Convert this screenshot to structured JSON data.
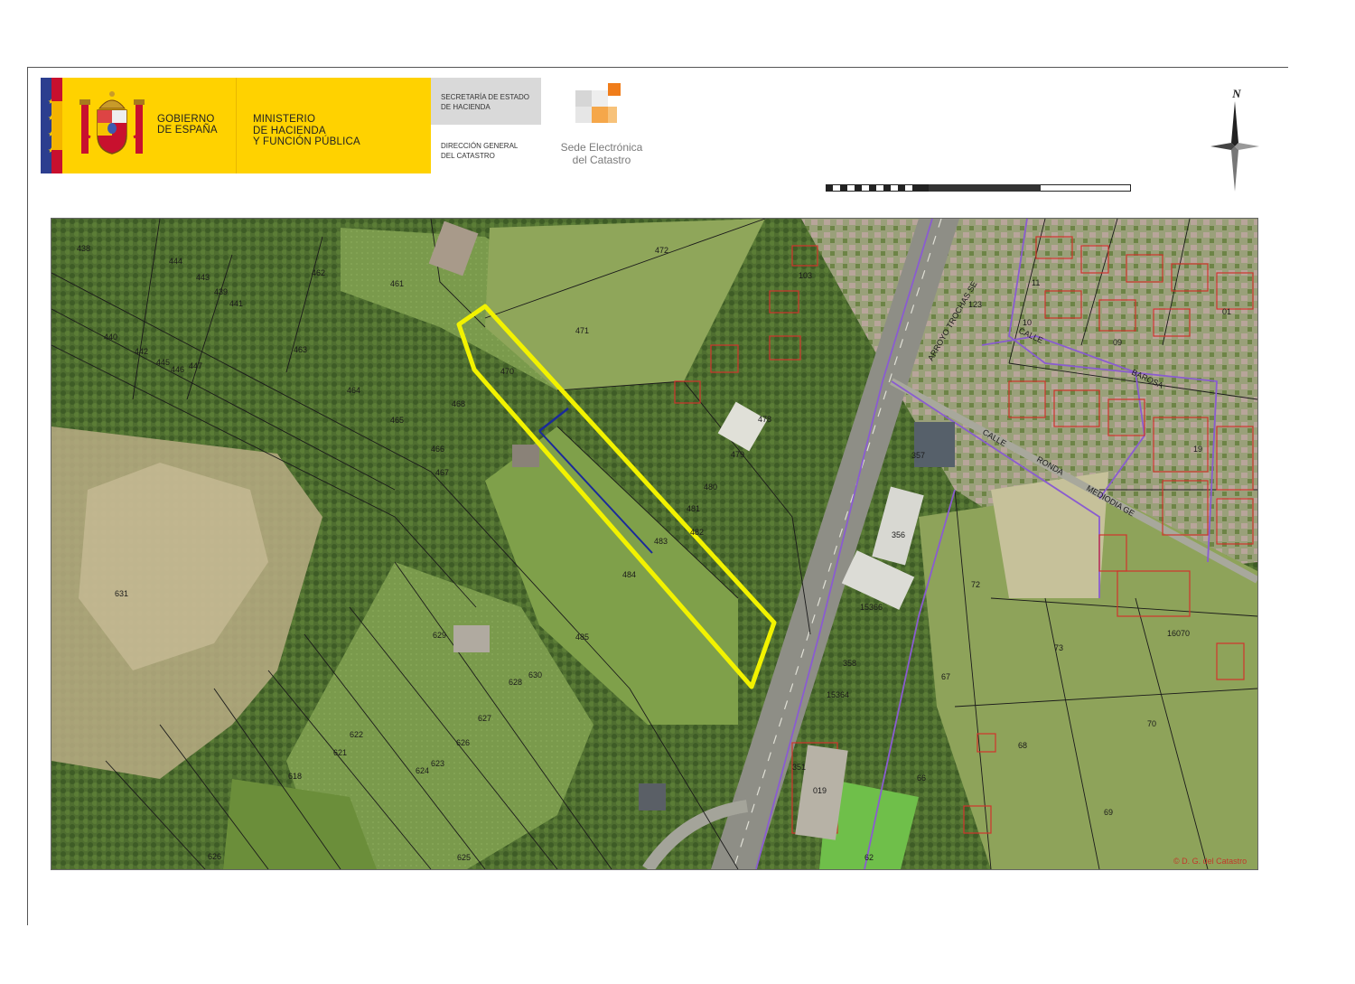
{
  "header": {
    "gobierno_line1": "GOBIERNO",
    "gobierno_line2": "DE ESPAÑA",
    "ministerio_line1": "MINISTERIO",
    "ministerio_line2": "DE HACIENDA",
    "ministerio_line3": "Y FUNCIÓN PÚBLICA",
    "secretaria_line1": "SECRETARÍA DE ESTADO",
    "secretaria_line2": "DE HACIENDA",
    "direccion_line1": "DIRECCIÓN GENERAL",
    "direccion_line2": "DEL CATASTRO",
    "sede_line1": "Sede Electrónica",
    "sede_line2": "del Catastro"
  },
  "north_label": "N",
  "colors": {
    "gov_yellow": "#ffd200",
    "spain_red": "#c8102e",
    "parcel_highlight": "#f2f200",
    "division_line": "#1a2a9a",
    "municipal_boundary": "#8a5cd0",
    "cadastral_red": "#d0342c",
    "sede_orange": "#f07d1a"
  },
  "map": {
    "copyright": "© D. G. del Catastro",
    "streets": [
      "CALLE",
      "RONDA",
      "MEDIODIA GE",
      "CALLE",
      "BAROSA",
      "ARROYO TROCHAS SE"
    ],
    "parcels": [
      {
        "id": "471"
      },
      {
        "id": "472"
      },
      {
        "id": "470"
      },
      {
        "id": "481"
      },
      {
        "id": "482"
      },
      {
        "id": "483"
      },
      {
        "id": "484"
      },
      {
        "id": "485"
      },
      {
        "id": "480"
      },
      {
        "id": "479"
      },
      {
        "id": "478"
      },
      {
        "id": "461"
      },
      {
        "id": "462"
      },
      {
        "id": "463"
      },
      {
        "id": "464"
      },
      {
        "id": "465"
      },
      {
        "id": "466"
      },
      {
        "id": "467"
      },
      {
        "id": "468"
      },
      {
        "id": "440"
      },
      {
        "id": "441"
      },
      {
        "id": "442"
      },
      {
        "id": "443"
      },
      {
        "id": "444"
      },
      {
        "id": "445"
      },
      {
        "id": "446"
      },
      {
        "id": "447"
      },
      {
        "id": "438"
      },
      {
        "id": "439"
      },
      {
        "id": "631"
      },
      {
        "id": "629"
      },
      {
        "id": "630"
      },
      {
        "id": "628"
      },
      {
        "id": "627"
      },
      {
        "id": "626"
      },
      {
        "id": "625"
      },
      {
        "id": "624"
      },
      {
        "id": "623"
      },
      {
        "id": "622"
      },
      {
        "id": "621"
      },
      {
        "id": "618"
      },
      {
        "id": "626"
      },
      {
        "id": "103"
      },
      {
        "id": "123"
      },
      {
        "id": "356"
      },
      {
        "id": "357"
      },
      {
        "id": "15366"
      },
      {
        "id": "15364"
      },
      {
        "id": "358"
      },
      {
        "id": "351"
      },
      {
        "id": "019"
      },
      {
        "id": "72"
      },
      {
        "id": "67"
      },
      {
        "id": "66"
      },
      {
        "id": "68"
      },
      {
        "id": "69"
      },
      {
        "id": "70"
      },
      {
        "id": "73"
      },
      {
        "id": "62"
      },
      {
        "id": "16070"
      },
      {
        "id": "10"
      },
      {
        "id": "11"
      },
      {
        "id": "09"
      },
      {
        "id": "01"
      },
      {
        "id": "19"
      }
    ]
  }
}
